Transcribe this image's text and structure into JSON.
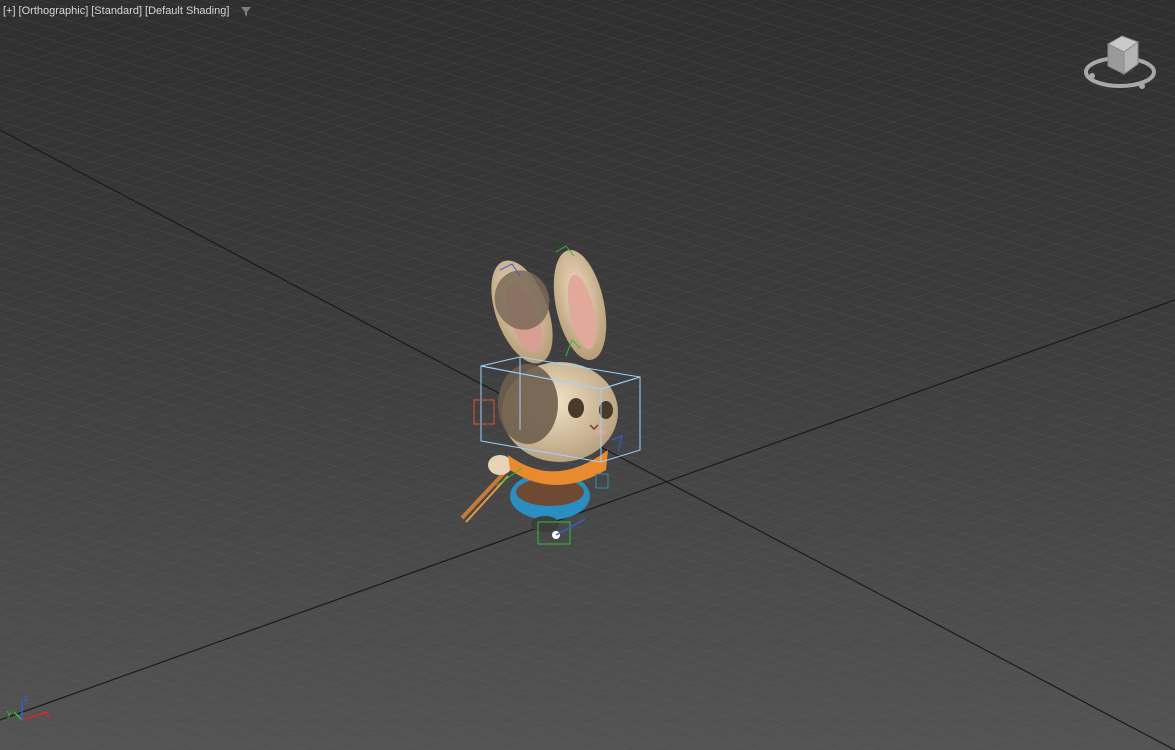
{
  "viewport": {
    "labels": {
      "plus": "[+]",
      "projection": "[Orthographic]",
      "view": "[Standard]",
      "shading": "[Default Shading]"
    },
    "filter_icon": "filter-funnel-icon"
  },
  "viewcube": {
    "icon": "viewcube-icon"
  },
  "axis": {
    "x": "x",
    "y": "y",
    "z": "z",
    "colors": {
      "x": "#d62a2a",
      "y": "#2fbf2f",
      "z": "#3a5bdc"
    }
  },
  "scene": {
    "object": "bunny-character",
    "selection_color": "#9fd2ff"
  }
}
